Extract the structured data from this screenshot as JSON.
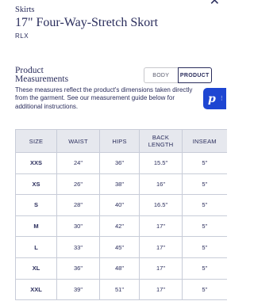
{
  "breadcrumb": "Skirts",
  "product_title": "17\" Four-Way-Stretch Skort",
  "brand": "RLX",
  "section": {
    "title_line1": "Product",
    "title_line2": "Measurements"
  },
  "toggle": {
    "body_label": "BODY",
    "product_label": "PRODUCT",
    "active": "PRODUCT"
  },
  "badge": {
    "letter": "p"
  },
  "description": "These measures reflect the product's dimensions taken directly from the garment. See our measurement guide below for additional instructions.",
  "table": {
    "headers": [
      "SIZE",
      "WAIST",
      "HIPS",
      "BACK LENGTH",
      "INSEAM"
    ],
    "rows": [
      [
        "XXS",
        "24\"",
        "36\"",
        "15.5\"",
        "5\""
      ],
      [
        "XS",
        "26\"",
        "38\"",
        "16\"",
        "5\""
      ],
      [
        "S",
        "28\"",
        "40\"",
        "16.5\"",
        "5\""
      ],
      [
        "M",
        "30\"",
        "42\"",
        "17\"",
        "5\""
      ],
      [
        "L",
        "33\"",
        "45\"",
        "17\"",
        "5\""
      ],
      [
        "XL",
        "36\"",
        "48\"",
        "17\"",
        "5\""
      ],
      [
        "XXL",
        "39\"",
        "51\"",
        "17\"",
        "5\""
      ]
    ]
  },
  "colors": {
    "text": "#2a2d5c",
    "header_bg": "#e6e8ee",
    "badge_bg": "#1e46d2",
    "border": "#c8ccd8"
  }
}
